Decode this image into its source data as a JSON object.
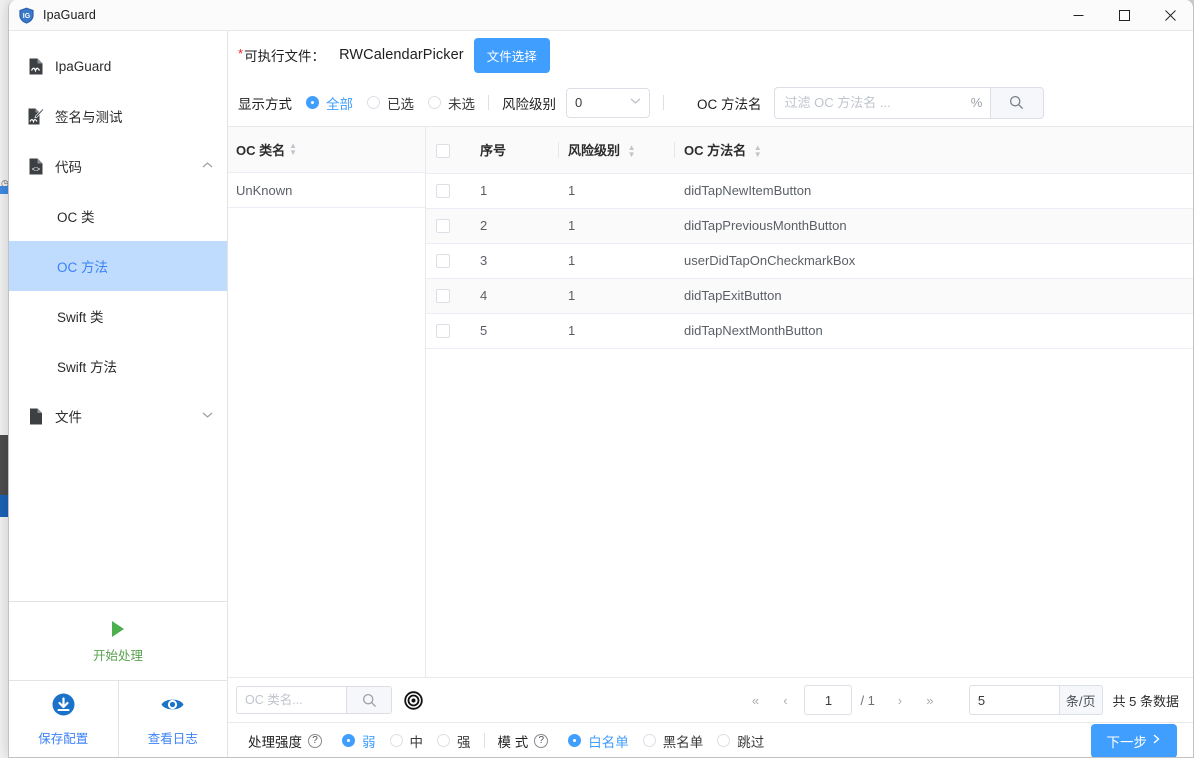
{
  "window": {
    "title": "IpaGuard",
    "logo_icon": "shield-ig-icon",
    "minimize_icon": "minimize-icon",
    "maximize_icon": "maximize-icon",
    "close_icon": "close-icon"
  },
  "sidebar": {
    "items": [
      {
        "label": "IpaGuard",
        "icon": "file-signature-icon",
        "type": "item"
      },
      {
        "label": "签名与测试",
        "icon": "file-pen-icon",
        "type": "item"
      },
      {
        "label": "代码",
        "icon": "file-code-icon",
        "type": "group",
        "chevron": "chevron-up-icon",
        "expanded": true
      },
      {
        "label": "OC 类",
        "type": "sub",
        "active": false
      },
      {
        "label": "OC 方法",
        "type": "sub",
        "active": true
      },
      {
        "label": "Swift 类",
        "type": "sub",
        "active": false
      },
      {
        "label": "Swift 方法",
        "type": "sub",
        "active": false
      },
      {
        "label": "文件",
        "icon": "file-icon",
        "type": "group",
        "chevron": "chevron-down-icon",
        "expanded": false
      }
    ],
    "actions": {
      "start": {
        "label": "开始处理",
        "icon": "play-icon",
        "color": "#59a14f"
      },
      "save": {
        "label": "保存配置",
        "icon": "download-circle-icon",
        "color": "#3b82f6"
      },
      "log": {
        "label": "查看日志",
        "icon": "eye-circle-icon",
        "color": "#3b82f6"
      }
    }
  },
  "toolbar": {
    "required_mark": "*",
    "exe_label": "可执行文件：",
    "exe_value": "RWCalendarPicker",
    "choose_file_button": "文件选择",
    "display_mode_label": "显示方式",
    "display_modes": [
      {
        "label": "全部",
        "selected": true
      },
      {
        "label": "已选",
        "selected": false
      },
      {
        "label": "未选",
        "selected": false
      }
    ],
    "risk_label": "风险级别",
    "risk_value": "0",
    "risk_caret_icon": "chevron-down-icon",
    "filter_label": "OC 方法名",
    "filter_placeholder": "过滤 OC 方法名 ...",
    "filter_value": "",
    "filter_pct_icon": "percent-icon",
    "filter_search_icon": "search-icon"
  },
  "class_pane": {
    "header": "OC 类名",
    "sort_icon": "sort-icon",
    "rows": [
      "UnKnown"
    ]
  },
  "table": {
    "columns": [
      {
        "key": "checkbox",
        "label": "",
        "sortable": false,
        "icon": "checkbox-icon"
      },
      {
        "key": "index",
        "label": "序号",
        "sortable": false
      },
      {
        "key": "risk",
        "label": "风险级别",
        "sortable": true
      },
      {
        "key": "method",
        "label": "OC 方法名",
        "sortable": true
      }
    ],
    "rows": [
      {
        "index": "1",
        "risk": "1",
        "method": "didTapNewItemButton",
        "checked": false
      },
      {
        "index": "2",
        "risk": "1",
        "method": "didTapPreviousMonthButton",
        "checked": false
      },
      {
        "index": "3",
        "risk": "1",
        "method": "userDidTapOnCheckmarkBox",
        "checked": false
      },
      {
        "index": "4",
        "risk": "1",
        "method": "didTapExitButton",
        "checked": false
      },
      {
        "index": "5",
        "risk": "1",
        "method": "didTapNextMonthButton",
        "checked": false
      }
    ]
  },
  "bottom_search": {
    "placeholder": "OC 类名...",
    "value": "",
    "search_icon": "search-icon",
    "target_icon": "target-icon"
  },
  "pagination": {
    "first_icon": "double-chevron-left-icon",
    "prev_icon": "chevron-left-icon",
    "page": "1",
    "total_pages": "/ 1",
    "next_icon": "chevron-right-icon",
    "last_icon": "double-chevron-right-icon",
    "page_size": "5",
    "page_size_unit": "条/页",
    "total_text": "共 5 条数据"
  },
  "options_bar": {
    "strength_label": "处理强度",
    "strength_help_icon": "help-icon",
    "strength_options": [
      {
        "label": "弱",
        "selected": true
      },
      {
        "label": "中",
        "selected": false
      },
      {
        "label": "强",
        "selected": false
      }
    ],
    "mode_label": "模 式",
    "mode_help_icon": "help-icon",
    "mode_options": [
      {
        "label": "白名单",
        "selected": true
      },
      {
        "label": "黑名单",
        "selected": false
      },
      {
        "label": "跳过",
        "selected": false
      }
    ],
    "next_button": "下一步",
    "next_button_icon": "chevron-right-icon"
  },
  "colors": {
    "accent": "#409eff",
    "active_nav_bg": "#bfdbfe",
    "active_nav_text": "#3b82f6",
    "green": "#59a14f",
    "required": "#f5222d"
  }
}
